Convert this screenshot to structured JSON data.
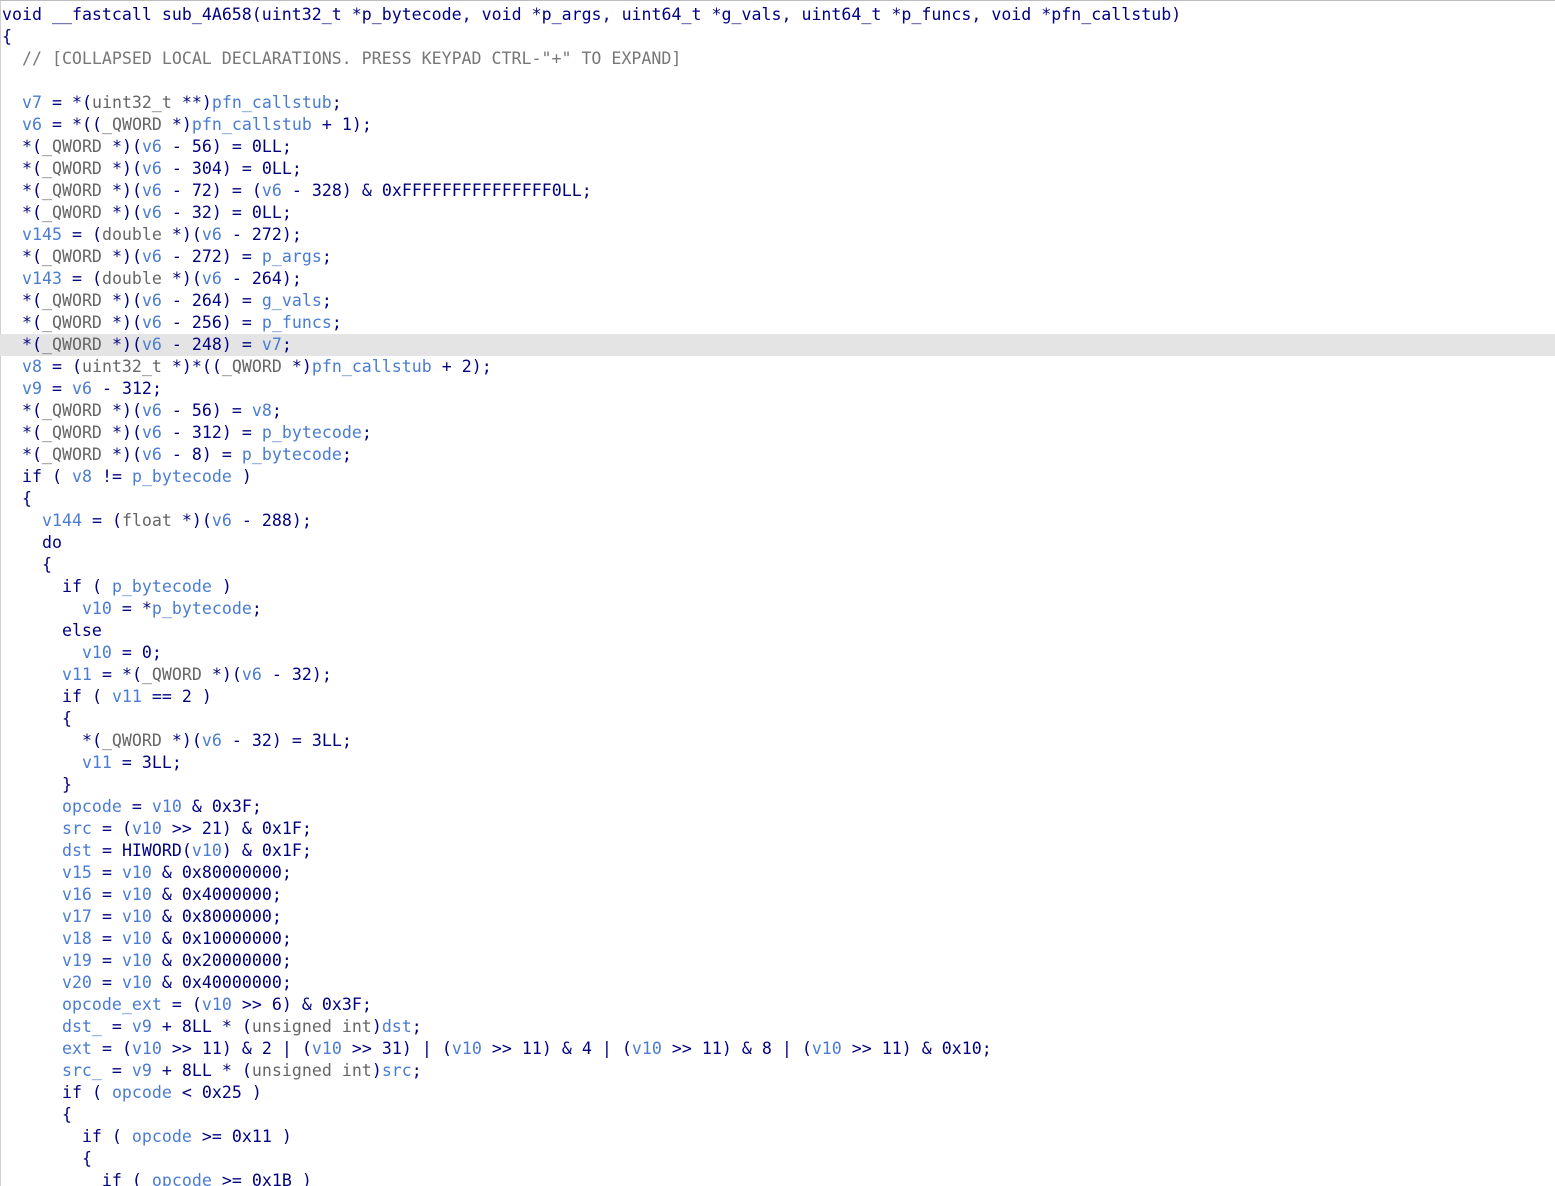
{
  "window": {
    "title": "Pseudocode view"
  },
  "colors": {
    "background": "#ffffff",
    "keyword": "#000080",
    "variable": "#4a7cd1",
    "type": "#666666",
    "comment": "#777777",
    "highlight": "#e4e4e4"
  },
  "code": {
    "highlighted_line": 15,
    "lines": [
      "void __fastcall sub_4A658(uint32_t *p_bytecode, void *p_args, uint64_t *g_vals, uint64_t *p_funcs, void *pfn_callstub)",
      "{",
      "  // [COLLAPSED LOCAL DECLARATIONS. PRESS KEYPAD CTRL-\"+\" TO EXPAND]",
      "",
      "  v7 = *(uint32_t **)pfn_callstub;",
      "  v6 = *((_QWORD *)pfn_callstub + 1);",
      "  *(_QWORD *)(v6 - 56) = 0LL;",
      "  *(_QWORD *)(v6 - 304) = 0LL;",
      "  *(_QWORD *)(v6 - 72) = (v6 - 328) & 0xFFFFFFFFFFFFFFF0LL;",
      "  *(_QWORD *)(v6 - 32) = 0LL;",
      "  v145 = (double *)(v6 - 272);",
      "  *(_QWORD *)(v6 - 272) = p_args;",
      "  v143 = (double *)(v6 - 264);",
      "  *(_QWORD *)(v6 - 264) = g_vals;",
      "  *(_QWORD *)(v6 - 256) = p_funcs;",
      "  *(_QWORD *)(v6 - 248) = v7;",
      "  v8 = (uint32_t *)*((_QWORD *)pfn_callstub + 2);",
      "  v9 = v6 - 312;",
      "  *(_QWORD *)(v6 - 56) = v8;",
      "  *(_QWORD *)(v6 - 312) = p_bytecode;",
      "  *(_QWORD *)(v6 - 8) = p_bytecode;",
      "  if ( v8 != p_bytecode )",
      "  {",
      "    v144 = (float *)(v6 - 288);",
      "    do",
      "    {",
      "      if ( p_bytecode )",
      "        v10 = *p_bytecode;",
      "      else",
      "        v10 = 0;",
      "      v11 = *(_QWORD *)(v6 - 32);",
      "      if ( v11 == 2 )",
      "      {",
      "        *(_QWORD *)(v6 - 32) = 3LL;",
      "        v11 = 3LL;",
      "      }",
      "      opcode = v10 & 0x3F;",
      "      src = (v10 >> 21) & 0x1F;",
      "      dst = HIWORD(v10) & 0x1F;",
      "      v15 = v10 & 0x80000000;",
      "      v16 = v10 & 0x4000000;",
      "      v17 = v10 & 0x8000000;",
      "      v18 = v10 & 0x10000000;",
      "      v19 = v10 & 0x20000000;",
      "      v20 = v10 & 0x40000000;",
      "      opcode_ext = (v10 >> 6) & 0x3F;",
      "      dst_ = v9 + 8LL * (unsigned int)dst;",
      "      ext = (v10 >> 11) & 2 | (v10 >> 31) | (v10 >> 11) & 4 | (v10 >> 11) & 8 | (v10 >> 11) & 0x10;",
      "      src_ = v9 + 8LL * (unsigned int)src;",
      "      if ( opcode < 0x25 )",
      "      {",
      "        if ( opcode >= 0x11 )",
      "        {",
      "          if ( opcode >= 0x1B )"
    ]
  }
}
